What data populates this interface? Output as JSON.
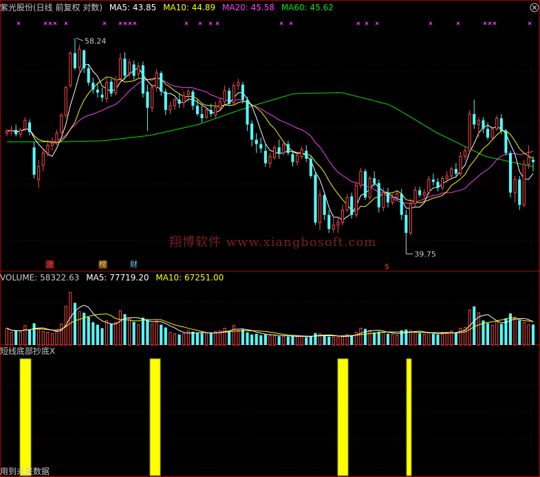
{
  "header": {
    "title": "紫光股份(日线 前复权 对数)",
    "ma5": "MA5: 43.85",
    "ma10": "MA10: 44.89",
    "ma20": "MA20: 45.58",
    "ma60": "MA60: 45.62"
  },
  "volume_header": {
    "label": "VOLUME: 58322.63",
    "ma5": "MA5: 77719.20",
    "ma10": "MA10: 67251.00"
  },
  "indicator_header": {
    "label": "短线底部抄底X"
  },
  "footer": {
    "text": "用到未来数据"
  },
  "watermark": "翔博软件 www.xiangbosoft.com",
  "markers": [
    {
      "text": "涨",
      "color": "#ff4040",
      "bg": "#5a1414"
    },
    {
      "text": "榜",
      "color": "#ffd24d",
      "bg": "#5a3a14"
    },
    {
      "text": "财",
      "color": "#80c8ff",
      "bg": "#000000"
    },
    {
      "text": "$",
      "color": "#ff3030",
      "bg": "#000000"
    }
  ],
  "colors": {
    "background": "#000000",
    "up": "#ff4a4a",
    "down": "#54fcfc",
    "frame": "#b40000",
    "ma5": "#ffffff",
    "ma10": "#ffff00",
    "ma20": "#ff40ff",
    "ma60": "#00e600",
    "signal": "#ffff00",
    "signal_edge": "#999900",
    "x_marker": "#ff40ff",
    "text": "#c8c8c8",
    "watermark": "#7a1f24"
  },
  "chart_data": {
    "type": "candlestick",
    "scale": "log",
    "ylim": [
      37.5,
      61
    ],
    "volume_ylim": [
      0,
      180000
    ],
    "annotations": {
      "high": "58.24",
      "low": "39.75"
    },
    "ma_windows": [
      5,
      10,
      20,
      60
    ],
    "volume_ma_windows": [
      5,
      10
    ],
    "ma60_path": [
      47.8,
      47.8,
      47.9,
      48.4,
      49.4,
      51.0,
      52.4,
      52.5,
      51.3,
      48.6,
      46.5,
      45.6
    ],
    "bars": [
      [
        48.6,
        49.0,
        48.3,
        48.8,
        48000
      ],
      [
        48.8,
        49.3,
        48.4,
        48.9,
        36000
      ],
      [
        48.9,
        49.4,
        48.3,
        48.5,
        40000
      ],
      [
        48.5,
        49.1,
        48.2,
        48.9,
        37000
      ],
      [
        49.0,
        50.1,
        48.8,
        49.8,
        55000
      ],
      [
        49.6,
        49.9,
        48.4,
        48.7,
        44000
      ],
      [
        47.3,
        47.8,
        44.6,
        44.9,
        62000
      ],
      [
        44.5,
        46.2,
        43.8,
        45.6,
        45000
      ],
      [
        45.7,
        47.1,
        45.2,
        46.8,
        38000
      ],
      [
        46.8,
        48.0,
        46.5,
        47.5,
        36000
      ],
      [
        47.5,
        48.2,
        47.0,
        47.7,
        32000
      ],
      [
        47.8,
        48.9,
        47.5,
        48.6,
        41000
      ],
      [
        48.7,
        50.5,
        48.5,
        50.3,
        60000
      ],
      [
        50.3,
        53.2,
        50.0,
        53.0,
        110000
      ],
      [
        53.2,
        56.8,
        53.0,
        56.6,
        150000
      ],
      [
        56.6,
        58.24,
        54.8,
        55.0,
        120000
      ],
      [
        55.1,
        57.5,
        54.6,
        57.0,
        95000
      ],
      [
        56.9,
        57.0,
        54.5,
        55.0,
        92000
      ],
      [
        55.0,
        55.4,
        53.2,
        53.5,
        80000
      ],
      [
        53.5,
        54.0,
        52.4,
        52.8,
        65000
      ],
      [
        52.8,
        53.5,
        52.0,
        52.5,
        58000
      ],
      [
        52.3,
        53.0,
        51.6,
        52.0,
        48000
      ],
      [
        51.9,
        54.0,
        51.5,
        53.5,
        70000
      ],
      [
        53.6,
        53.9,
        52.1,
        52.4,
        60000
      ],
      [
        52.5,
        54.2,
        52.2,
        53.8,
        64000
      ],
      [
        53.9,
        56.6,
        53.5,
        56.0,
        98000
      ],
      [
        56.0,
        56.7,
        53.8,
        54.2,
        88000
      ],
      [
        54.5,
        56.0,
        54.0,
        55.6,
        76000
      ],
      [
        55.4,
        55.8,
        53.8,
        54.2,
        66000
      ],
      [
        54.4,
        55.6,
        53.9,
        55.2,
        58000
      ],
      [
        55.3,
        55.7,
        52.0,
        52.4,
        78000
      ],
      [
        52.6,
        53.3,
        48.8,
        51.0,
        70000
      ],
      [
        51.0,
        53.4,
        50.6,
        53.0,
        60000
      ],
      [
        53.0,
        54.9,
        52.6,
        54.5,
        68000
      ],
      [
        54.5,
        54.7,
        52.2,
        52.6,
        58000
      ],
      [
        52.6,
        52.9,
        50.3,
        50.8,
        50000
      ],
      [
        50.8,
        51.6,
        50.4,
        51.2,
        36000
      ],
      [
        51.2,
        52.0,
        50.8,
        51.8,
        32000
      ],
      [
        51.8,
        52.4,
        51.0,
        51.4,
        30000
      ],
      [
        51.5,
        52.6,
        51.0,
        52.2,
        32000
      ],
      [
        52.3,
        52.9,
        51.6,
        52.6,
        40000
      ],
      [
        52.6,
        52.8,
        50.8,
        51.2,
        38000
      ],
      [
        51.2,
        51.8,
        50.2,
        50.4,
        34000
      ],
      [
        50.4,
        51.2,
        49.6,
        50.0,
        34000
      ],
      [
        50.1,
        51.0,
        49.9,
        50.8,
        32000
      ],
      [
        50.8,
        51.4,
        50.1,
        50.4,
        34000
      ],
      [
        50.3,
        51.6,
        50.0,
        51.0,
        38000
      ],
      [
        51.0,
        52.0,
        50.8,
        51.6,
        40000
      ],
      [
        51.6,
        53.2,
        51.3,
        52.7,
        48000
      ],
      [
        52.7,
        53.0,
        51.2,
        51.4,
        40000
      ],
      [
        51.5,
        53.5,
        51.3,
        53.2,
        56000
      ],
      [
        53.2,
        53.9,
        52.8,
        53.5,
        42000
      ],
      [
        53.3,
        53.6,
        51.4,
        51.8,
        44000
      ],
      [
        51.8,
        52.1,
        48.8,
        49.4,
        36000
      ],
      [
        49.5,
        49.8,
        47.4,
        48.0,
        30000
      ],
      [
        48.0,
        48.6,
        46.8,
        47.6,
        32000
      ],
      [
        47.6,
        48.2,
        46.8,
        47.2,
        28000
      ],
      [
        47.0,
        47.6,
        45.6,
        45.9,
        30000
      ],
      [
        45.9,
        46.8,
        45.5,
        46.5,
        28000
      ],
      [
        46.4,
        47.5,
        46.2,
        47.3,
        26000
      ],
      [
        47.3,
        48.0,
        46.3,
        46.8,
        25000
      ],
      [
        46.8,
        47.8,
        46.6,
        47.6,
        26000
      ],
      [
        47.6,
        47.9,
        46.6,
        46.8,
        24000
      ],
      [
        46.7,
        46.9,
        45.6,
        46.0,
        26000
      ],
      [
        46.0,
        46.9,
        45.7,
        46.6,
        24000
      ],
      [
        46.5,
        47.4,
        46.3,
        47.1,
        24000
      ],
      [
        47.0,
        47.5,
        46.0,
        46.3,
        22000
      ],
      [
        46.3,
        46.5,
        44.6,
        44.8,
        26000
      ],
      [
        44.9,
        45.2,
        40.8,
        41.0,
        34000
      ],
      [
        41.0,
        43.6,
        40.4,
        43.2,
        32000
      ],
      [
        43.2,
        43.5,
        41.2,
        41.6,
        28000
      ],
      [
        41.6,
        42.0,
        40.2,
        40.5,
        24000
      ],
      [
        40.5,
        41.6,
        40.2,
        40.8,
        22000
      ],
      [
        40.8,
        41.4,
        40.2,
        41.0,
        22000
      ],
      [
        41.0,
        42.4,
        40.8,
        42.0,
        26000
      ],
      [
        42.0,
        43.3,
        41.8,
        43.0,
        30000
      ],
      [
        43.1,
        43.4,
        41.3,
        41.6,
        28000
      ],
      [
        41.6,
        44.3,
        41.4,
        44.0,
        36000
      ],
      [
        44.0,
        45.5,
        43.8,
        45.2,
        48000
      ],
      [
        45.2,
        45.4,
        42.8,
        43.0,
        46000
      ],
      [
        43.0,
        44.8,
        42.8,
        44.6,
        42000
      ],
      [
        44.6,
        45.2,
        43.9,
        44.2,
        36000
      ],
      [
        44.2,
        44.5,
        41.8,
        42.2,
        38000
      ],
      [
        42.2,
        43.8,
        41.9,
        43.4,
        36000
      ],
      [
        43.4,
        43.8,
        42.2,
        42.6,
        32000
      ],
      [
        42.6,
        43.3,
        42.4,
        43.0,
        30000
      ],
      [
        43.0,
        43.5,
        42.8,
        43.3,
        28000
      ],
      [
        43.3,
        43.7,
        41.2,
        41.6,
        42000
      ],
      [
        41.6,
        42.0,
        39.75,
        40.2,
        44000
      ],
      [
        40.2,
        42.9,
        40.0,
        42.5,
        40000
      ],
      [
        42.5,
        43.9,
        42.3,
        43.6,
        38000
      ],
      [
        43.6,
        43.9,
        43.0,
        43.2,
        34000
      ],
      [
        43.2,
        43.7,
        42.9,
        43.4,
        30000
      ],
      [
        43.4,
        44.8,
        43.2,
        44.5,
        36000
      ],
      [
        44.5,
        45.0,
        44.0,
        44.3,
        32000
      ],
      [
        44.3,
        44.6,
        43.5,
        43.8,
        30000
      ],
      [
        43.8,
        44.8,
        43.6,
        44.6,
        34000
      ],
      [
        44.6,
        45.2,
        44.2,
        44.8,
        36000
      ],
      [
        44.8,
        45.6,
        44.6,
        45.4,
        40000
      ],
      [
        45.4,
        45.9,
        44.8,
        45.0,
        36000
      ],
      [
        45.0,
        46.9,
        44.8,
        46.5,
        48000
      ],
      [
        46.5,
        47.4,
        46.2,
        47.0,
        50000
      ],
      [
        47.0,
        50.8,
        46.8,
        50.4,
        100000
      ],
      [
        50.4,
        51.8,
        49.0,
        49.4,
        110000
      ],
      [
        49.4,
        50.1,
        48.2,
        49.8,
        92000
      ],
      [
        49.8,
        50.1,
        48.6,
        49.0,
        70000
      ],
      [
        49.0,
        49.6,
        48.0,
        48.2,
        62000
      ],
      [
        48.2,
        49.2,
        47.9,
        49.0,
        56000
      ],
      [
        49.0,
        50.3,
        48.8,
        50.0,
        66000
      ],
      [
        50.0,
        50.4,
        48.5,
        48.8,
        60000
      ],
      [
        48.8,
        49.0,
        46.6,
        46.8,
        76000
      ],
      [
        46.8,
        47.0,
        43.0,
        43.4,
        90000
      ],
      [
        43.4,
        44.8,
        42.6,
        44.5,
        80000
      ],
      [
        44.5,
        44.8,
        42.0,
        42.4,
        70000
      ],
      [
        42.4,
        46.2,
        42.2,
        45.8,
        64000
      ],
      [
        45.8,
        47.5,
        45.4,
        46.4,
        58000
      ],
      [
        46.2,
        46.5,
        45.2,
        46.0,
        58322.63
      ]
    ]
  }
}
